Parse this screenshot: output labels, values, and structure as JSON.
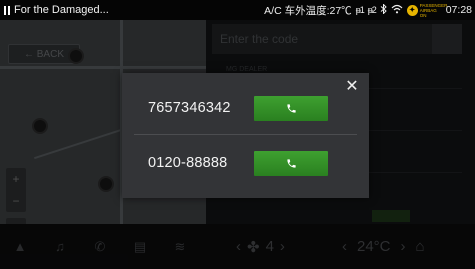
{
  "status_bar": {
    "title": "For the Damaged...",
    "ac_label": "A/C 车外温度:27℃",
    "signal1": "ᵽ1",
    "signal2": "ᵽ2",
    "bt_icon": "bluetooth-icon",
    "wifi_icon": "wifi-icon",
    "airbag_text": "PASSENGER AIRBAG ON",
    "time": "07:28"
  },
  "background_app": {
    "back_label": "← BACK",
    "search_placeholder": "Enter the code",
    "tab_labels": [
      "MG DEALER",
      "",
      ""
    ],
    "zoom_in": "+",
    "zoom_out": "−"
  },
  "dialog": {
    "close_icon": "close-icon",
    "entries": [
      {
        "number": "7657346342",
        "call_icon": "phone-icon"
      },
      {
        "number": "0120-88888",
        "call_icon": "phone-icon"
      }
    ],
    "accent_color": "#339228"
  },
  "bottom_bar": {
    "fan_level": "4",
    "temperature": "24°C"
  }
}
